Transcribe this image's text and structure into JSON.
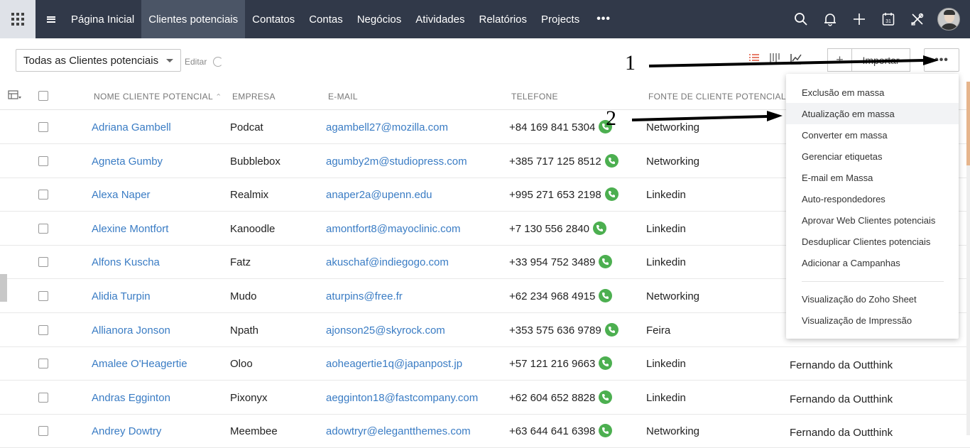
{
  "nav": {
    "items": [
      {
        "label": "Página Inicial",
        "active": false
      },
      {
        "label": "Clientes potenciais",
        "active": true
      },
      {
        "label": "Contatos",
        "active": false
      },
      {
        "label": "Contas",
        "active": false
      },
      {
        "label": "Negócios",
        "active": false
      },
      {
        "label": "Atividades",
        "active": false
      },
      {
        "label": "Relatórios",
        "active": false
      },
      {
        "label": "Projects",
        "active": false
      }
    ],
    "more_label": "•••",
    "icons": [
      "search-icon",
      "bell-icon",
      "plus-icon",
      "calendar-icon",
      "tools-icon",
      "avatar"
    ]
  },
  "toolbar": {
    "view_select": "Todas as Clientes potenciais",
    "edit_label": "Editar",
    "import_label": "Importar",
    "create_label": "+",
    "more_label": "•••"
  },
  "table": {
    "headers": {
      "name": "NOME CLIENTE POTENCIAL",
      "company": "EMPRESA",
      "email": "E-MAIL",
      "phone": "TELEFONE",
      "source": "FONTE DE CLIENTE POTENCIAL"
    },
    "rows": [
      {
        "name": "Adriana Gambell",
        "company": "Podcat",
        "email": "agambell27@mozilla.com",
        "phone": "+84 169 841 5304",
        "source": "Networking",
        "owner": ""
      },
      {
        "name": "Agneta Gumby",
        "company": "Bubblebox",
        "email": "agumby2m@studiopress.com",
        "phone": "+385 717 125 8512",
        "source": "Networking",
        "owner": ""
      },
      {
        "name": "Alexa Naper",
        "company": "Realmix",
        "email": "anaper2a@upenn.edu",
        "phone": "+995 271 653 2198",
        "source": "Linkedin",
        "owner": ""
      },
      {
        "name": "Alexine Montfort",
        "company": "Kanoodle",
        "email": "amontfort8@mayoclinic.com",
        "phone": "+7 130 556 2840",
        "source": "Linkedin",
        "owner": ""
      },
      {
        "name": "Alfons Kuscha",
        "company": "Fatz",
        "email": "akuschaf@indiegogo.com",
        "phone": "+33 954 752 3489",
        "source": "Linkedin",
        "owner": ""
      },
      {
        "name": "Alidia Turpin",
        "company": "Mudo",
        "email": "aturpins@free.fr",
        "phone": "+62 234 968 4915",
        "source": "Networking",
        "owner": ""
      },
      {
        "name": "Allianora Jonson",
        "company": "Npath",
        "email": "ajonson25@skyrock.com",
        "phone": "+353 575 636 9789",
        "source": "Feira",
        "owner": ""
      },
      {
        "name": "Amalee O'Heagertie",
        "company": "Oloo",
        "email": "aoheagertie1q@japanpost.jp",
        "phone": "+57 121 216 9663",
        "source": "Linkedin",
        "owner": "Fernando da Outthink"
      },
      {
        "name": "Andras Egginton",
        "company": "Pixonyx",
        "email": "aegginton18@fastcompany.com",
        "phone": "+62 604 652 8828",
        "source": "Linkedin",
        "owner": "Fernando da Outthink"
      },
      {
        "name": "Andrey Dowtry",
        "company": "Meembee",
        "email": "adowtryr@elegantthemes.com",
        "phone": "+63 644 641 6398",
        "source": "Networking",
        "owner": "Fernando da Outthink"
      }
    ]
  },
  "dropdown": {
    "group1": [
      "Exclusão em massa",
      "Atualização em massa",
      "Converter em massa",
      "Gerenciar etiquetas",
      "E-mail em Massa",
      "Auto-respondedores",
      "Aprovar Web Clientes potenciais",
      "Desduplicar Clientes potenciais",
      "Adicionar a Campanhas"
    ],
    "group2": [
      "Visualização do Zoho Sheet",
      "Visualização de Impressão"
    ],
    "highlighted_index": 1
  },
  "annotations": {
    "label1": "1",
    "label2": "2"
  },
  "colors": {
    "nav_bg": "#313949",
    "nav_active": "#4b5566",
    "link": "#3a7cc4",
    "phone_green": "#4caf50"
  }
}
